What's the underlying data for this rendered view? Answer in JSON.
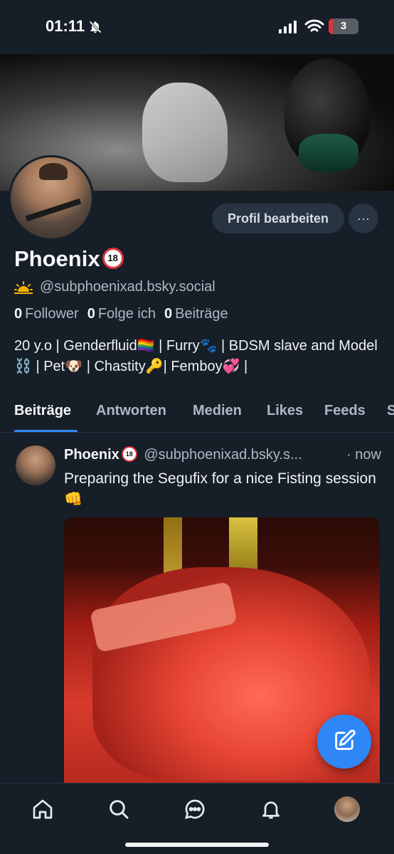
{
  "status": {
    "time": "01:11",
    "battery": "3",
    "icons": [
      "bell-off-icon",
      "signal-icon",
      "wifi-icon",
      "battery-icon"
    ]
  },
  "profile": {
    "display_name": "Phoenix",
    "adult_badge": "18",
    "handle": "@subphoenixad.bsky.social",
    "edit_button": "Profil bearbeiten",
    "more_button": "···",
    "stats": {
      "followers_count": "0",
      "followers_label": "Follower",
      "following_count": "0",
      "following_label": "Folge ich",
      "posts_count": "0",
      "posts_label": "Beiträge"
    },
    "bio": "20 y.o | Genderfluid🏳️‍🌈 | Furry🐾 | BDSM slave and Model⛓️ | Pet🐶 | Chastity🔑| Femboy💞 |"
  },
  "tabs": [
    {
      "label": "Beiträge",
      "active": true
    },
    {
      "label": "Antworten"
    },
    {
      "label": "Medien"
    },
    {
      "label": "Likes"
    },
    {
      "label": "Feeds"
    },
    {
      "label": "S"
    }
  ],
  "post": {
    "author": "Phoenix",
    "badge": "18",
    "handle": "@subphoenixad.bsky.s...",
    "time": "· now",
    "text": "Preparing the Segufix for a nice Fisting session👊"
  },
  "colors": {
    "background": "#161e27",
    "accent": "#2f86f7",
    "muted_text": "#aeb8c3",
    "button_bg": "#283442"
  }
}
